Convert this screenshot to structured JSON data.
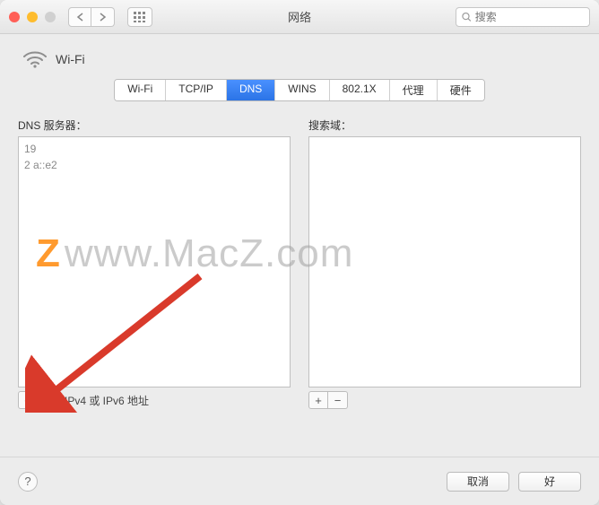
{
  "window": {
    "title": "网络",
    "search_placeholder": "搜索"
  },
  "network": {
    "name": "Wi-Fi"
  },
  "tabs": [
    {
      "label": "Wi-Fi",
      "active": false
    },
    {
      "label": "TCP/IP",
      "active": false
    },
    {
      "label": "DNS",
      "active": true
    },
    {
      "label": "WINS",
      "active": false
    },
    {
      "label": "802.1X",
      "active": false
    },
    {
      "label": "代理",
      "active": false
    },
    {
      "label": "硬件",
      "active": false
    }
  ],
  "dns_panel": {
    "label": "DNS 服务器：",
    "rows": [
      "19",
      "2                         a::e2"
    ],
    "footer_note": "IPv4 或 IPv6 地址"
  },
  "search_panel": {
    "label": "搜索域：",
    "rows": []
  },
  "buttons": {
    "cancel": "取消",
    "ok": "好",
    "plus": "+",
    "minus": "−",
    "help": "?"
  },
  "watermark": {
    "z": "Z",
    "text": "www.MacZ.com"
  }
}
